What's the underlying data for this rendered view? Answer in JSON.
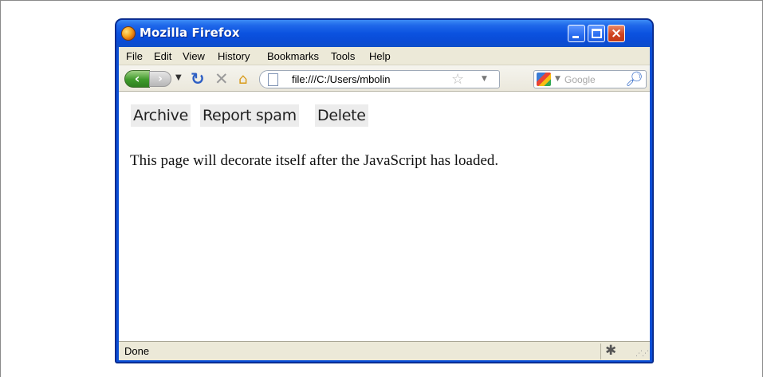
{
  "window": {
    "title": "Mozilla Firefox",
    "controls": {
      "minimize": "minimize",
      "maximize": "maximize",
      "close": "×"
    }
  },
  "menubar": {
    "items": [
      {
        "label": "File"
      },
      {
        "label": "Edit"
      },
      {
        "label": "View"
      },
      {
        "label": "History"
      },
      {
        "label": "Bookmarks"
      },
      {
        "label": "Tools"
      },
      {
        "label": "Help"
      }
    ]
  },
  "navbar": {
    "back_icon": "back-arrow-icon",
    "forward_icon": "forward-arrow-icon",
    "reload_icon": "reload-icon",
    "stop_icon": "stop-icon",
    "home_icon": "home-icon",
    "address": "file:///C:/Users/mbolin",
    "search_placeholder": "Google"
  },
  "page": {
    "buttons": [
      {
        "label": "Archive"
      },
      {
        "label": "Report spam"
      },
      {
        "label": "Delete"
      }
    ],
    "message": "This page will decorate itself after the JavaScript has loaded."
  },
  "statusbar": {
    "text": "Done"
  },
  "colors": {
    "titlebar": "#0b52e0",
    "chrome_gray": "#ece9d8",
    "button_bg": "#ececec"
  }
}
